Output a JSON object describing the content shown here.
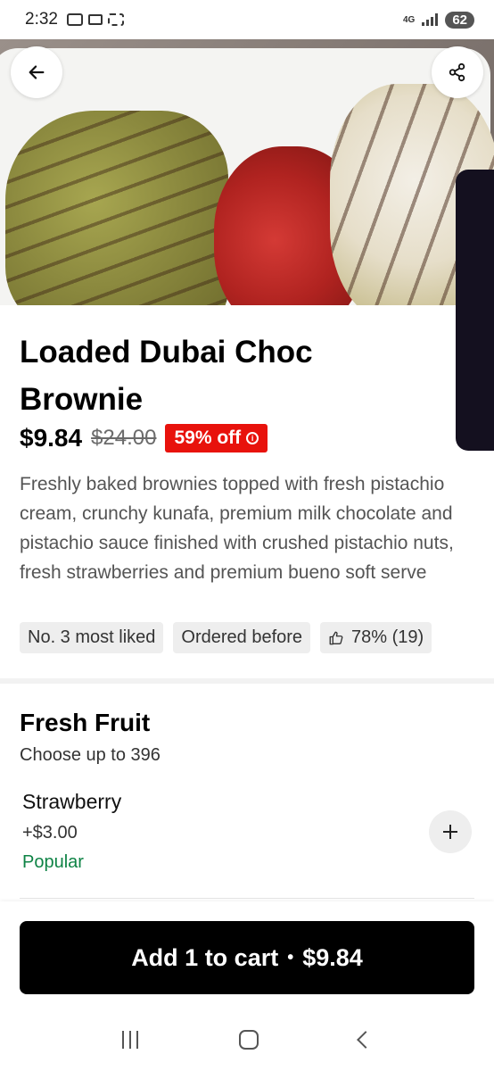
{
  "status_bar": {
    "time": "2:32",
    "network": "4G",
    "battery": "62",
    "icons": [
      "gallery-icon",
      "video-icon",
      "screenshot-icon",
      "signal-icon",
      "battery-icon"
    ]
  },
  "hero": {
    "back_icon": "arrow-left-icon",
    "share_icon": "share-icon"
  },
  "product": {
    "title": "Loaded Dubai Choc Brownie",
    "price": "$9.84",
    "original_price": "$24.00",
    "discount_label": "59% off",
    "description": "Freshly baked brownies topped with fresh pistachio cream, crunchy kunafa, premium milk chocolate and pistachio sauce finished with crushed pistachio nuts, fresh strawberries and premium bueno soft serve",
    "tags": [
      "No. 3 most liked",
      "Ordered before",
      "78% (19)"
    ]
  },
  "section": {
    "title": "Fresh Fruit",
    "subtitle": "Choose up to 396",
    "option": {
      "name": "Strawberry",
      "price": "+$3.00",
      "badge": "Popular"
    }
  },
  "cart": {
    "label": "Add 1 to cart",
    "separator": "•",
    "price": "$9.84"
  },
  "colors": {
    "discount_red": "#e8120c",
    "popular_green": "#0e8345",
    "cart_button": "#000000"
  }
}
